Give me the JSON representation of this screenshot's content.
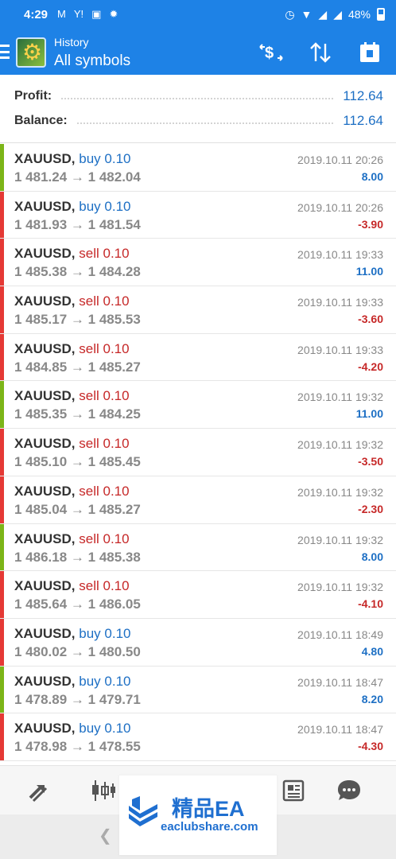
{
  "status_bar": {
    "time": "4:29",
    "battery": "48%",
    "left_icons": [
      "gmail-icon",
      "signal-app-icon",
      "message-icon",
      "pinwheel-icon"
    ],
    "right_icons": [
      "alarm-icon",
      "wifi-icon",
      "cell-signal-icon",
      "cell-signal-icon",
      "battery-icon"
    ]
  },
  "app_bar": {
    "subtitle": "History",
    "title": "All symbols",
    "actions": [
      "currency-exchange-icon",
      "sort-icon",
      "calendar-icon"
    ]
  },
  "summary": {
    "profit_label": "Profit:",
    "profit_value": "112.64",
    "balance_label": "Balance:",
    "balance_value": "112.64"
  },
  "colors": {
    "accent": "#1e82e6",
    "buy": "#1d6fc4",
    "sell": "#c62828",
    "profit_bar": "#7cb518",
    "loss_bar": "#e53935",
    "positive": "#1d6fc4",
    "negative": "#c62828"
  },
  "deals": [
    {
      "symbol": "XAUUSD,",
      "side": "buy",
      "volume": "0.10",
      "open": "1 481.24",
      "close": "1 482.04",
      "time": "2019.10.11 20:26",
      "profit": "8.00",
      "result": "win"
    },
    {
      "symbol": "XAUUSD,",
      "side": "buy",
      "volume": "0.10",
      "open": "1 481.93",
      "close": "1 481.54",
      "time": "2019.10.11 20:26",
      "profit": "-3.90",
      "result": "loss"
    },
    {
      "symbol": "XAUUSD,",
      "side": "sell",
      "volume": "0.10",
      "open": "1 485.38",
      "close": "1 484.28",
      "time": "2019.10.11 19:33",
      "profit": "11.00",
      "result": "loss"
    },
    {
      "symbol": "XAUUSD,",
      "side": "sell",
      "volume": "0.10",
      "open": "1 485.17",
      "close": "1 485.53",
      "time": "2019.10.11 19:33",
      "profit": "-3.60",
      "result": "loss"
    },
    {
      "symbol": "XAUUSD,",
      "side": "sell",
      "volume": "0.10",
      "open": "1 484.85",
      "close": "1 485.27",
      "time": "2019.10.11 19:33",
      "profit": "-4.20",
      "result": "loss"
    },
    {
      "symbol": "XAUUSD,",
      "side": "sell",
      "volume": "0.10",
      "open": "1 485.35",
      "close": "1 484.25",
      "time": "2019.10.11 19:32",
      "profit": "11.00",
      "result": "win"
    },
    {
      "symbol": "XAUUSD,",
      "side": "sell",
      "volume": "0.10",
      "open": "1 485.10",
      "close": "1 485.45",
      "time": "2019.10.11 19:32",
      "profit": "-3.50",
      "result": "loss"
    },
    {
      "symbol": "XAUUSD,",
      "side": "sell",
      "volume": "0.10",
      "open": "1 485.04",
      "close": "1 485.27",
      "time": "2019.10.11 19:32",
      "profit": "-2.30",
      "result": "loss"
    },
    {
      "symbol": "XAUUSD,",
      "side": "sell",
      "volume": "0.10",
      "open": "1 486.18",
      "close": "1 485.38",
      "time": "2019.10.11 19:32",
      "profit": "8.00",
      "result": "win"
    },
    {
      "symbol": "XAUUSD,",
      "side": "sell",
      "volume": "0.10",
      "open": "1 485.64",
      "close": "1 486.05",
      "time": "2019.10.11 19:32",
      "profit": "-4.10",
      "result": "loss"
    },
    {
      "symbol": "XAUUSD,",
      "side": "buy",
      "volume": "0.10",
      "open": "1 480.02",
      "close": "1 480.50",
      "time": "2019.10.11 18:49",
      "profit": "4.80",
      "result": "loss"
    },
    {
      "symbol": "XAUUSD,",
      "side": "buy",
      "volume": "0.10",
      "open": "1 478.89",
      "close": "1 479.71",
      "time": "2019.10.11 18:47",
      "profit": "8.20",
      "result": "win"
    },
    {
      "symbol": "XAUUSD,",
      "side": "buy",
      "volume": "0.10",
      "open": "1 478.98",
      "close": "1 478.55",
      "time": "2019.10.11 18:47",
      "profit": "-4.30",
      "result": "loss"
    }
  ],
  "arrow": "→",
  "bottom_nav": [
    "quotes-icon",
    "chart-icon",
    "trade-icon",
    "history-icon",
    "news-icon",
    "chat-icon"
  ],
  "watermark": {
    "title": "精品EA",
    "url": "eaclubshare.com"
  }
}
